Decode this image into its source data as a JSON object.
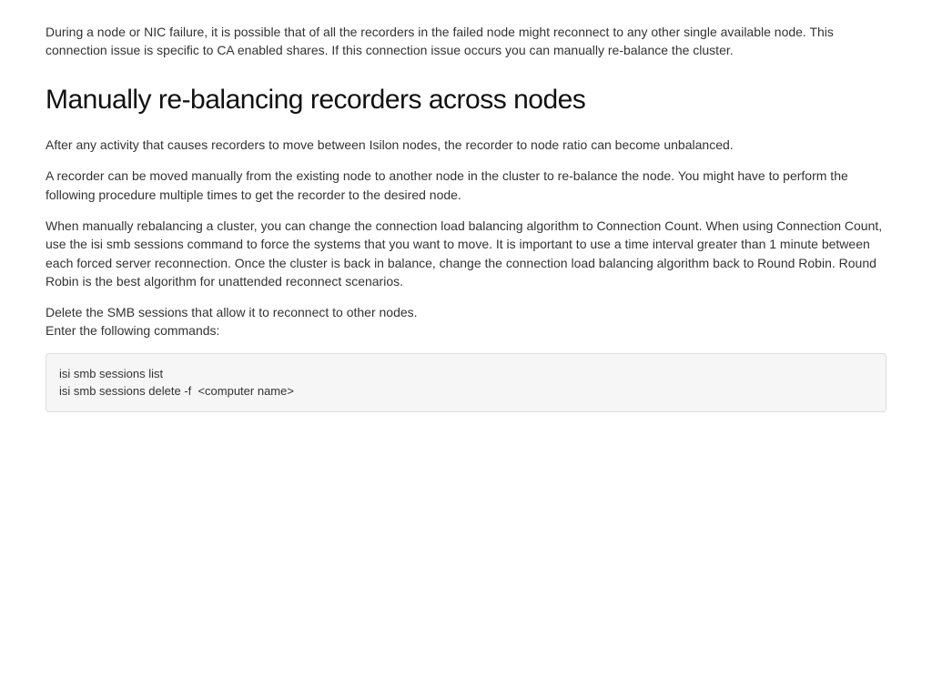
{
  "intro": "During a node or NIC failure, it is possible that of all the recorders in the failed node might reconnect to any other single available node. This connection issue is specific to CA enabled shares. If this connection issue occurs you can manually re-balance the cluster.",
  "heading": "Manually re-balancing recorders across nodes",
  "para1": "After any activity that causes recorders to move between Isilon nodes, the recorder to node ratio can become unbalanced.",
  "para2": "A recorder can be moved manually from the existing node to another node in the cluster to re-balance the node. You might have to perform the following procedure multiple times to get the recorder to the desired node.",
  "para3": "When manually rebalancing a cluster, you can change the connection load balancing algorithm to Connection Count. When using Connection Count, use the isi smb sessions command to force the systems that you want to move. It is important to use a time interval greater than 1 minute between each forced server reconnection. Once the cluster is back in balance, change the connection load balancing algorithm back to Round Robin. Round Robin is the best algorithm for unattended reconnect scenarios.",
  "instruction1": "Delete the SMB sessions that allow it to reconnect to other nodes.",
  "instruction2": "Enter the following commands:",
  "code": "isi smb sessions list\nisi smb sessions delete -f  <computer name>"
}
